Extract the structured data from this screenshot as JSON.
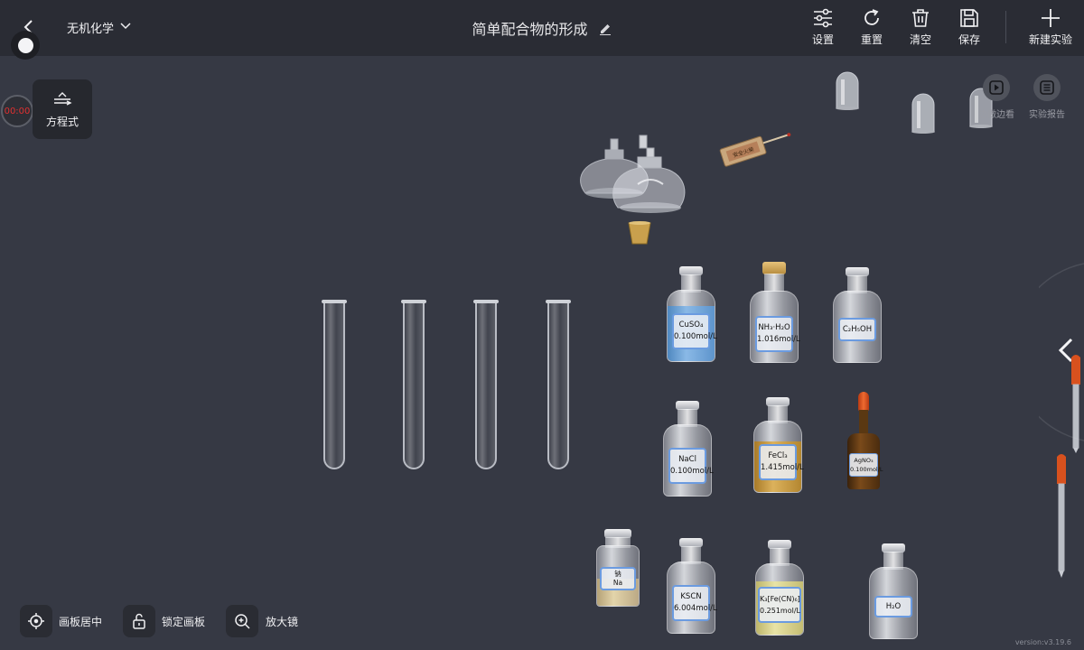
{
  "topbar": {
    "subject": "无机化学",
    "title": "简单配合物的形成",
    "buttons": {
      "settings": "设置",
      "reset": "重置",
      "clear": "清空",
      "save": "保存",
      "new": "新建实验"
    }
  },
  "timer": "00:00",
  "equation_button": "方程式",
  "right_tools": {
    "watch": "边做边看",
    "report": "实验报告"
  },
  "bottles": {
    "cuso4": {
      "name": "CuSO₄",
      "conc": "0.100mol/L"
    },
    "nh3": {
      "name": "NH₃·H₂O",
      "conc": "1.016mol/L"
    },
    "ethanol": {
      "name": "C₂H₅OH",
      "conc": ""
    },
    "nacl": {
      "name": "NaCl",
      "conc": "0.100mol/L"
    },
    "fecl3": {
      "name": "FeCl₃",
      "conc": "1.415mol/L"
    },
    "agno3": {
      "name": "AgNO₃",
      "conc": "0.100mol/L"
    },
    "sodium": {
      "name": "钠",
      "conc": "Na"
    },
    "kscn": {
      "name": "KSCN",
      "conc": "6.004mol/L"
    },
    "k3fecn6": {
      "name": "K₃[Fe(CN)₆]",
      "conc": "0.251mol/L"
    },
    "water": {
      "name": "H₂O",
      "conc": ""
    }
  },
  "bottom": {
    "center": "画板居中",
    "lock": "锁定画板",
    "zoom": "放大镜"
  },
  "version": "version:v3.19.6",
  "colors": {
    "canvas": "#363944",
    "topbar": "#2a2c34",
    "timer": "#e03030",
    "cuso4_liquid": "#6aa3d8",
    "fecl3_liquid": "#c89a3a",
    "k3fecn6_liquid": "#d8d28a",
    "label_border": "#6b9be0"
  }
}
